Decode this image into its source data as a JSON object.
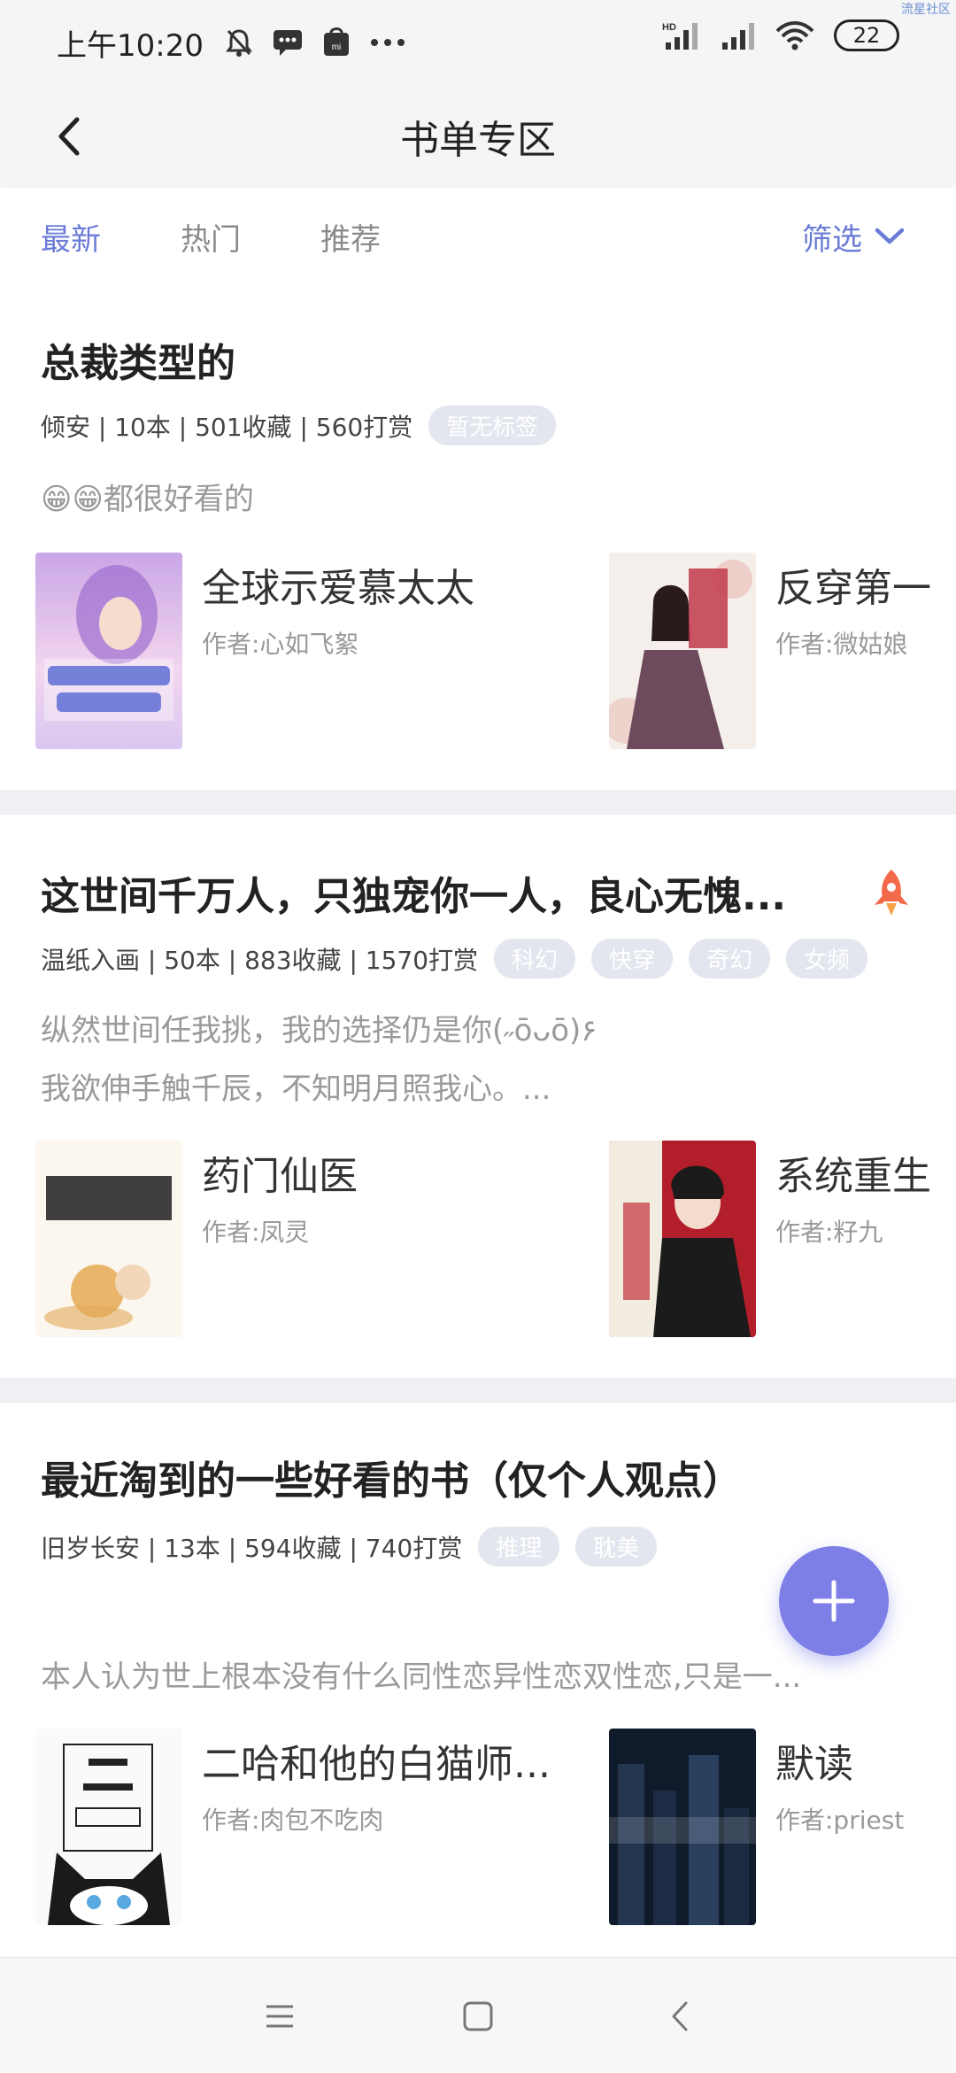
{
  "status_bar": {
    "time": "上午10:20",
    "battery": "22",
    "corner_mark": "流星社区"
  },
  "header": {
    "title": "书单专区"
  },
  "tabs": [
    {
      "label": "最新",
      "active": true
    },
    {
      "label": "热门",
      "active": false
    },
    {
      "label": "推荐",
      "active": false
    }
  ],
  "filter": {
    "label": "筛选"
  },
  "lists": [
    {
      "title": "总裁类型的",
      "meta": "倾安 | 10本 | 501收藏 | 560打赏",
      "tags": [
        "暂无标签"
      ],
      "desc": [
        "😁😁都很好看的"
      ],
      "books": [
        {
          "name": "全球示爱慕太太",
          "author": "作者:心如飞絮"
        },
        {
          "name": "反穿第一",
          "author": "作者:微姑娘"
        }
      ]
    },
    {
      "title": "这世间千万人，只独宠你一人，良心无愧...",
      "meta": "温纸入画 | 50本 | 883收藏 | 1570打赏",
      "tags": [
        "科幻",
        "快穿",
        "奇幻",
        "女频"
      ],
      "desc": [
        "纵然世间任我挑，我的选择仍是你(˶ōᴗō)۶",
        "我欲伸手触千辰，不知明月照我心。..."
      ],
      "books": [
        {
          "name": "药门仙医",
          "author": "作者:凤灵"
        },
        {
          "name": "系统重生",
          "author": "作者:籽九"
        }
      ]
    },
    {
      "title": "最近淘到的一些好看的书（仅个人观点）",
      "meta": "旧岁长安 | 13本 | 594收藏 | 740打赏",
      "tags": [
        "推理",
        "耽美"
      ],
      "desc": [
        "本人认为世上根本没有什么同性恋异性恋双性恋,只是一..."
      ],
      "books": [
        {
          "name": "二哈和他的白猫师...",
          "author": "作者:肉包不吃肉"
        },
        {
          "name": "默读",
          "author": "作者:priest"
        }
      ]
    }
  ],
  "colors": {
    "accent": "#6b7bd6",
    "fab": "#7d7ee6",
    "tag_bg": "#e3e6ee"
  },
  "icons": [
    "back-icon",
    "chevron-down-icon",
    "rocket-icon",
    "plus-icon",
    "menu-icon",
    "home-icon",
    "nav-back-icon"
  ]
}
